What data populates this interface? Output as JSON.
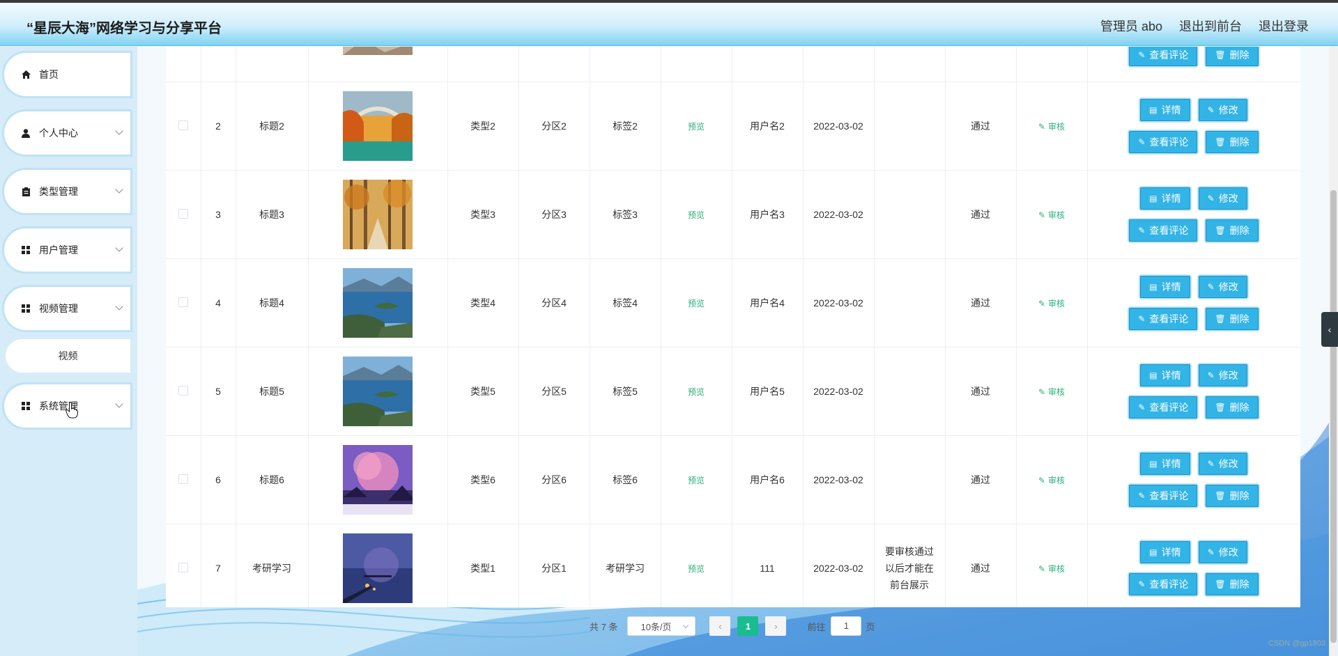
{
  "header": {
    "title": "“星辰大海”网络学习与分享平台",
    "admin": "管理员 abo",
    "back_front": "退出到前台",
    "logout": "退出登录"
  },
  "sidebar": {
    "items": [
      {
        "label": "首页",
        "icon": "home-icon"
      },
      {
        "label": "个人中心",
        "icon": "user-icon"
      },
      {
        "label": "类型管理",
        "icon": "clipboard-icon"
      },
      {
        "label": "用户管理",
        "icon": "grid-icon"
      },
      {
        "label": "视频管理",
        "icon": "grid-icon"
      },
      {
        "label": "系统管理",
        "icon": "grid-icon"
      }
    ],
    "sub_item": "视频"
  },
  "table": {
    "preview_label": "预览",
    "audit_label": "审核",
    "buttons": {
      "detail": "详情",
      "edit": "修改",
      "comments": "查看评论",
      "delete": "删除"
    },
    "rows": [
      {
        "id": "2",
        "title": "标题2",
        "type": "类型2",
        "zone": "分区2",
        "tag": "标签2",
        "user": "用户名2",
        "date": "2022-03-02",
        "note": "",
        "status": "通过",
        "thumb": "autumn-bridge"
      },
      {
        "id": "3",
        "title": "标题3",
        "type": "类型3",
        "zone": "分区3",
        "tag": "标签3",
        "user": "用户名3",
        "date": "2022-03-02",
        "note": "",
        "status": "通过",
        "thumb": "autumn-forest"
      },
      {
        "id": "4",
        "title": "标题4",
        "type": "类型4",
        "zone": "分区4",
        "tag": "标签4",
        "user": "用户名4",
        "date": "2022-03-02",
        "note": "",
        "status": "通过",
        "thumb": "lake"
      },
      {
        "id": "5",
        "title": "标题5",
        "type": "类型5",
        "zone": "分区5",
        "tag": "标签5",
        "user": "用户名5",
        "date": "2022-03-02",
        "note": "",
        "status": "通过",
        "thumb": "lake"
      },
      {
        "id": "6",
        "title": "标题6",
        "type": "类型6",
        "zone": "分区6",
        "tag": "标签6",
        "user": "用户名6",
        "date": "2022-03-02",
        "note": "",
        "status": "通过",
        "thumb": "pink-sky"
      },
      {
        "id": "7",
        "title": "考研学习",
        "type": "类型1",
        "zone": "分区1",
        "tag": "考研学习",
        "user": "111",
        "date": "2022-03-02",
        "note": "要审核通过以后才能在前台展示",
        "status": "通过",
        "thumb": "night-pier"
      }
    ]
  },
  "pagination": {
    "total": "共 7 条",
    "page_size": "10条/页",
    "current": "1",
    "goto": "前往",
    "goto_value": "1",
    "page_unit": "页"
  },
  "watermark": "CSDN @gp1803",
  "colors": {
    "accent": "#33b4e6",
    "green": "#19bd8f"
  }
}
